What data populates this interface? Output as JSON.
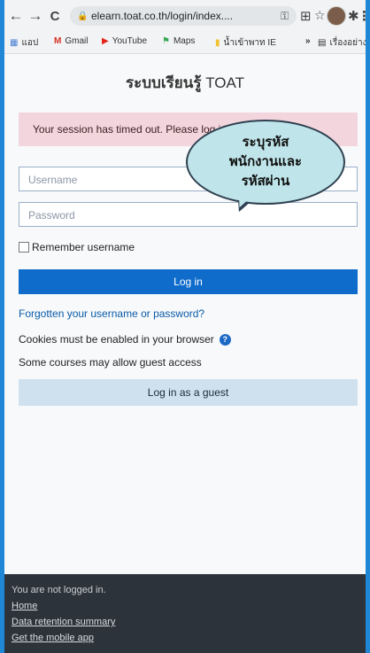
{
  "browser": {
    "url": "elearn.toat.co.th/login/index....",
    "back_icon": "←",
    "forward_icon": "→",
    "reload_icon": "C",
    "bookmarks": [
      {
        "label": "แอป",
        "icon": "apps-icon"
      },
      {
        "label": "Gmail",
        "icon": "gmail-icon"
      },
      {
        "label": "YouTube",
        "icon": "youtube-icon"
      },
      {
        "label": "Maps",
        "icon": "maps-icon"
      },
      {
        "label": "น้ำเข้าพาท IE",
        "icon": "folder-icon"
      },
      {
        "label": "»",
        "icon": "more-icon"
      },
      {
        "label": "เรื่องอย่าง",
        "icon": "reading-list-icon"
      }
    ]
  },
  "page": {
    "site_title_bold": "ระบบเรียนรู้",
    "site_title_rest": " TOAT",
    "alert": "Your session has timed out. Please log in again.",
    "username_placeholder": "Username",
    "password_placeholder": "Password",
    "remember_label": "Remember username",
    "login_button": "Log in",
    "forgot_link": "Forgotten your username or password?",
    "cookies_note": "Cookies must be enabled in your browser",
    "guest_note": "Some courses may allow guest access",
    "guest_button": "Log in as a guest"
  },
  "callout": {
    "line1": "ระบุรหัส",
    "line2": "พนักงานและ",
    "line3": "รหัสผ่าน"
  },
  "footer": {
    "status": "You are not logged in.",
    "home": "Home",
    "data_retention": "Data retention summary",
    "mobile_app": "Get the mobile app"
  },
  "colors": {
    "accent": "#0f6ccb",
    "alert_bg": "#f3d6dd",
    "footer_bg": "#2c333a",
    "outer_bg": "#1f87d6"
  }
}
